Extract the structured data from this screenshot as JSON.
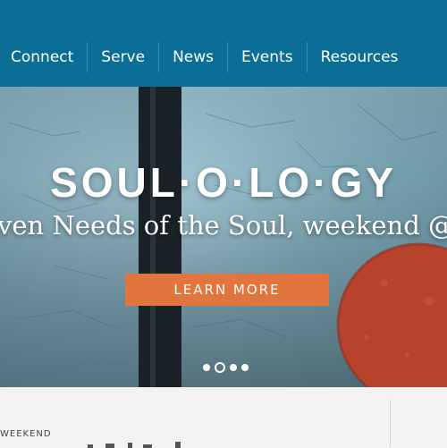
{
  "nav": {
    "items": [
      "Connect",
      "Serve",
      "News",
      "Events",
      "Resources"
    ]
  },
  "hero": {
    "title": "SOUL·O·LO·GY",
    "subtitle": "ven Needs of the Soul, weekend @",
    "cta_label": "LEARN MORE",
    "slides": {
      "count": 4,
      "active_index": 1
    }
  },
  "lower": {
    "eyebrow": "WEEKEND"
  },
  "colors": {
    "nav_bg": "#0a6e97",
    "cta_bg": "#e2743e",
    "accent_red": "#b8432c"
  }
}
